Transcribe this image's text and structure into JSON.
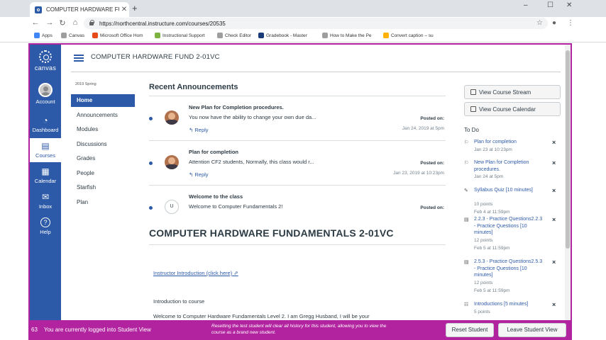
{
  "browser": {
    "tab_title": "COMPUTER HARDWARE FUNDAM...",
    "new_tab": "+",
    "url": "https://northcentral.instructure.com/courses/20535",
    "window_controls": [
      "–",
      "☐",
      "✕"
    ],
    "bookmarks": [
      {
        "label": "Apps",
        "color": "#4285f4"
      },
      {
        "label": "Canvas",
        "color": "#9e9e9e"
      },
      {
        "label": "Microsoft Office Hom",
        "color": "#e64a19"
      },
      {
        "label": "Instructional Support",
        "color": "#7cb342"
      },
      {
        "label": "Check Editor",
        "color": "#9e9e9e"
      },
      {
        "label": "Gradebook - Master",
        "color": "#1a3a7a"
      },
      {
        "label": "How to Make the Pe",
        "color": "#9e9e9e"
      },
      {
        "label": "Convert caption – su",
        "color": "#ffb300"
      }
    ]
  },
  "global_nav": {
    "logo": "canvas",
    "items": [
      {
        "label": "Account",
        "icon": "avatar-icon"
      },
      {
        "label": "Dashboard",
        "icon": "dashboard-icon"
      },
      {
        "label": "Courses",
        "icon": "courses-icon",
        "active": true
      },
      {
        "label": "Calendar",
        "icon": "calendar-icon"
      },
      {
        "label": "Inbox",
        "icon": "inbox-icon"
      },
      {
        "label": "Help",
        "icon": "help-icon"
      }
    ]
  },
  "header": {
    "course_title": "COMPUTER HARDWARE FUND 2-01VC"
  },
  "course_nav": {
    "term": "2019 Spring",
    "items": [
      "Home",
      "Announcements",
      "Modules",
      "Discussions",
      "Grades",
      "People",
      "Starfish",
      "Plan"
    ],
    "active_index": 0
  },
  "announcements": {
    "heading": "Recent Announcements",
    "items": [
      {
        "title": "New Plan for Completion procedures.",
        "body": "You now have the ability to change your own due da...",
        "reply": "Reply",
        "posted_label": "Posted on:",
        "date": "Jan 24, 2019 at 5pm",
        "avatar": "photo"
      },
      {
        "title": "Plan for completion",
        "body": "Attention CF2 students, Normally, this class would r...",
        "reply": "Reply",
        "posted_label": "Posted on:",
        "date": "Jan 23, 2019 at 10:23pm",
        "avatar": "photo"
      },
      {
        "title": "Welcome to the class",
        "body": "Welcome to Computer Fundamentals 2!",
        "reply": "",
        "posted_label": "Posted on:",
        "date": "",
        "avatar": "U"
      }
    ]
  },
  "content": {
    "page_heading": "COMPUTER HARDWARE FUNDAMENTALS 2-01VC",
    "intro_link": "Instructor Introduction (click here)",
    "intro_heading": "Introduction to course",
    "intro_text": "Welcome to Computer Hardware Fundamentals Level 2. I am Gregg Husband, I will be your"
  },
  "sidebar": {
    "buttons": [
      "View Course Stream",
      "View Course Calendar"
    ],
    "todo_heading": "To Do",
    "todo": [
      {
        "title": "Plan for completion",
        "meta": [
          "Jan 23 at 10:23pm"
        ],
        "icon": "announcement-icon"
      },
      {
        "title": "New Plan for Completion procedures.",
        "meta": [
          "Jan 24 at 5pm"
        ],
        "icon": "announcement-icon"
      },
      {
        "title": "Syllabus Quiz [10 minutes]",
        "meta": [
          "10 points",
          "Feb 4 at 11:59pm"
        ],
        "icon": "quiz-icon"
      },
      {
        "title": "2.2.3 - Practice Questions2.2.3 - Practice Questions [10 minutes]",
        "meta": [
          "12 points",
          "Feb 5 at 11:59pm"
        ],
        "icon": "assignment-icon"
      },
      {
        "title": "2.5.3 - Practice Questions2.5.3 - Practice Questions [10 minutes]",
        "meta": [
          "12 points",
          "Feb 5 at 11:59pm"
        ],
        "icon": "assignment-icon"
      },
      {
        "title": "Introductions [5 minutes]",
        "meta": [
          "5 points"
        ],
        "icon": "discussion-icon"
      }
    ],
    "dismiss": "×"
  },
  "student_view": {
    "message": "You are currently logged into Student View",
    "note": "Resetting the test student will clear all history for this student, allowing you to view the course as a brand new student.",
    "reset_label": "Reset Student",
    "leave_label": "Leave Student View"
  }
}
